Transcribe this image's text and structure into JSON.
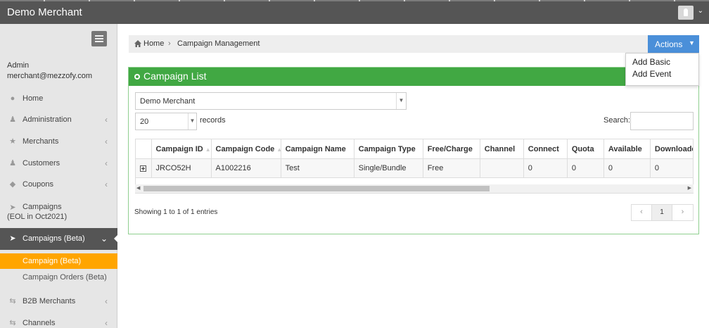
{
  "app": {
    "title": "Demo Merchant"
  },
  "sidebar": {
    "user_name": "Admin",
    "user_email": "merchant@mezzofy.com",
    "items": [
      {
        "label": "Home",
        "icon": "globe-icon"
      },
      {
        "label": "Administration",
        "icon": "user-icon"
      },
      {
        "label": "Merchants",
        "icon": "star-icon"
      },
      {
        "label": "Customers",
        "icon": "users-icon"
      },
      {
        "label": "Coupons",
        "icon": "tag-icon"
      },
      {
        "label": "Campaigns",
        "label_line2": "(EOL in Oct2021)",
        "icon": "rocket-icon"
      },
      {
        "label": "Campaigns (Beta)",
        "icon": "rocket-icon"
      },
      {
        "label": "B2B Merchants",
        "icon": "exchange-icon"
      },
      {
        "label": "Channels",
        "icon": "exchange-icon"
      }
    ],
    "subitems": [
      {
        "label": "Campaign (Beta)"
      },
      {
        "label": "Campaign Orders (Beta)"
      }
    ]
  },
  "breadcrumb": {
    "home": "Home",
    "separator": "›",
    "current": "Campaign Management"
  },
  "actions": {
    "label": "Actions",
    "menu": [
      "Add Basic",
      "Add Event"
    ]
  },
  "panel": {
    "title": "Campaign List"
  },
  "filters": {
    "merchant": "Demo Merchant",
    "page_length": "20",
    "records_label": "records",
    "search_label": "Search:",
    "search_value": ""
  },
  "table": {
    "columns": [
      "",
      "Campaign ID",
      "Campaign Code",
      "Campaign Name",
      "Campaign Type",
      "Free/Charge",
      "Channel",
      "Connect",
      "Quota",
      "Available",
      "Downloaded"
    ],
    "rows": [
      [
        "",
        "JRCO52H",
        "A1002216",
        "Test",
        "Single/Bundle",
        "Free",
        "",
        "0",
        "0",
        "0",
        "0"
      ]
    ]
  },
  "info": "Showing 1 to 1 of 1 entries",
  "pagination": {
    "prev": "‹",
    "current": "1",
    "next": "›"
  },
  "colors": {
    "topbar": "#555555",
    "sidebar": "#e6e6e6",
    "panel_header": "#41a843",
    "selected": "#ffa500",
    "actions": "#4a8fd9"
  }
}
